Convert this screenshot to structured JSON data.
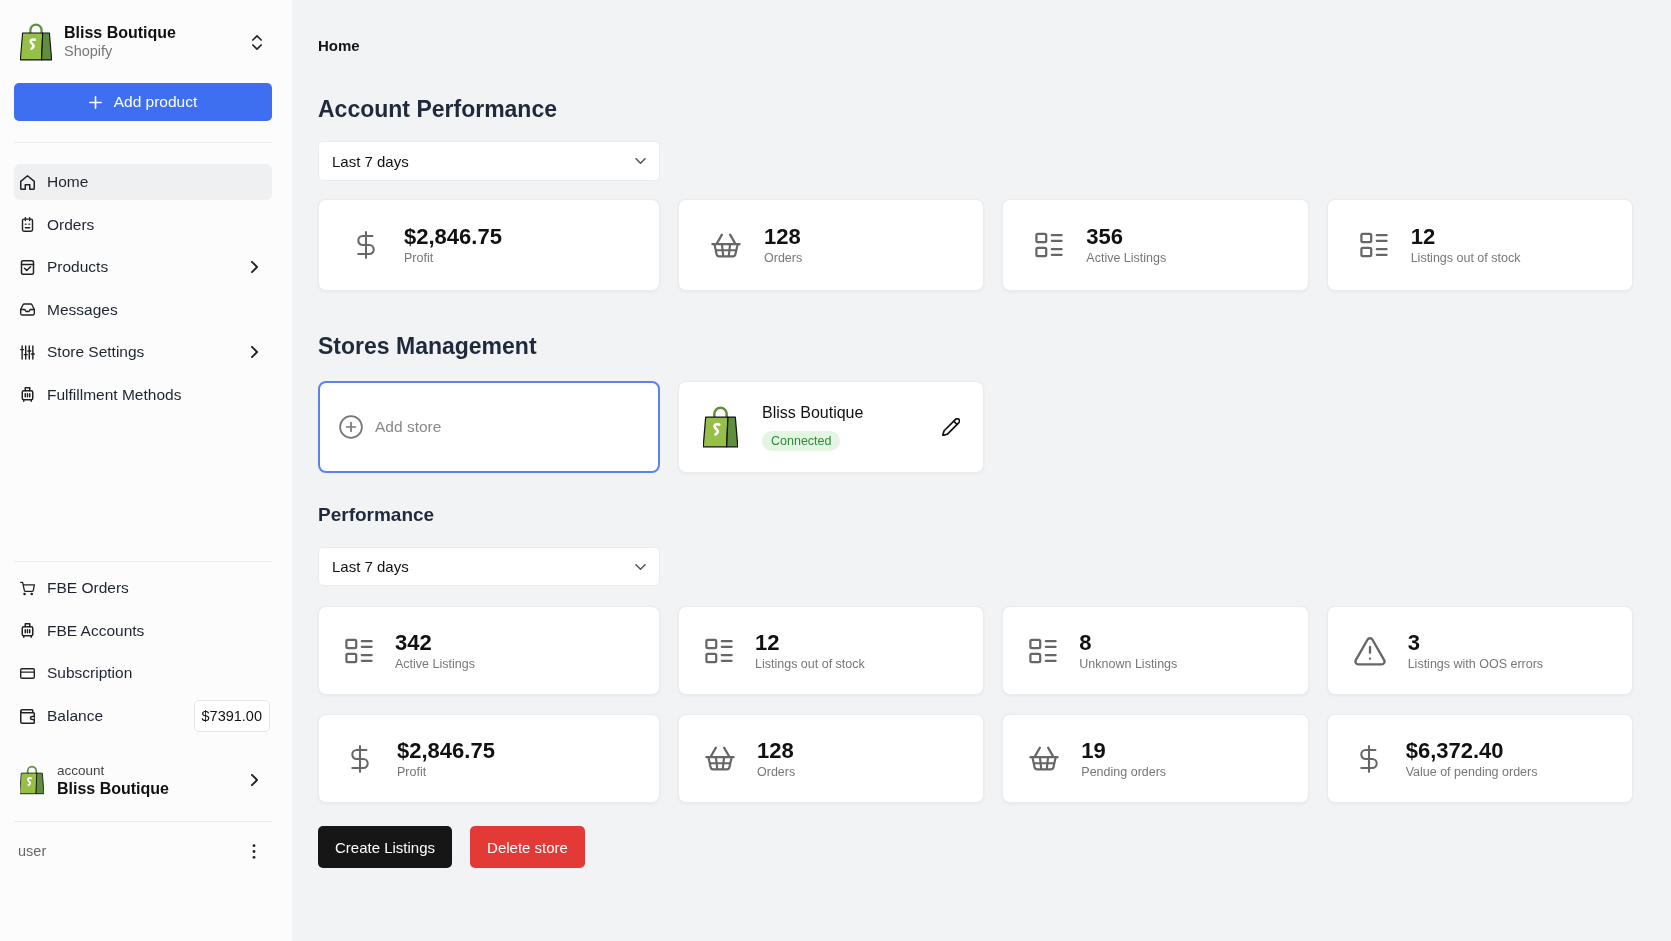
{
  "sidebar": {
    "store": {
      "name": "Bliss Boutique",
      "platform": "Shopify"
    },
    "add_button": {
      "label": "Add product"
    },
    "nav_items": [
      {
        "label": "Home",
        "selected": true,
        "expandable": false
      },
      {
        "label": "Orders",
        "selected": false,
        "expandable": false
      },
      {
        "label": "Products",
        "selected": false,
        "expandable": true
      },
      {
        "label": "Messages",
        "selected": false,
        "expandable": false
      },
      {
        "label": "Store Settings",
        "selected": false,
        "expandable": true
      },
      {
        "label": "Fulfillment Methods",
        "selected": false,
        "expandable": false
      }
    ],
    "secondary_items": [
      {
        "label": "FBE Orders",
        "selected": false
      },
      {
        "label": "FBE Accounts",
        "selected": false
      },
      {
        "label": "Subscription",
        "selected": false
      },
      {
        "label": "Balance",
        "selected": false,
        "badge": "$7391.00"
      }
    ],
    "account": {
      "caption": "account",
      "name": "Bliss Boutique"
    },
    "user": {
      "name": "user"
    }
  },
  "breadcrumb": "Home",
  "account_performance": {
    "title": "Account Performance",
    "period": {
      "value": "Last 7 days"
    },
    "stats": [
      {
        "kind": "money",
        "value": "$2,846.75",
        "label": "Profit"
      },
      {
        "kind": "orders",
        "value": "128",
        "label": "Orders"
      },
      {
        "kind": "listings",
        "value": "356",
        "label": "Active Listings"
      },
      {
        "kind": "listings",
        "value": "12",
        "label": "Listings out of stock"
      }
    ]
  },
  "stores_management": {
    "title": "Stores Management",
    "add_store": {
      "label": "Add store",
      "focused": true
    },
    "stores": [
      {
        "name": "Bliss Boutique",
        "status": "Connected"
      }
    ]
  },
  "performance": {
    "title": "Performance",
    "period": {
      "value": "Last 7 days"
    },
    "stats": [
      {
        "kind": "listings",
        "value": "342",
        "label": "Active Listings"
      },
      {
        "kind": "listings",
        "value": "12",
        "label": "Listings out of stock"
      },
      {
        "kind": "listings",
        "value": "8",
        "label": "Unknown Listings"
      },
      {
        "kind": "warning",
        "value": "3",
        "label": "Listings with OOS errors"
      },
      {
        "kind": "money",
        "value": "$2,846.75",
        "label": "Profit"
      },
      {
        "kind": "orders",
        "value": "128",
        "label": "Orders"
      },
      {
        "kind": "orders",
        "value": "19",
        "label": "Pending orders"
      },
      {
        "kind": "money",
        "value": "$6,372.40",
        "label": "Value of pending orders"
      }
    ]
  },
  "actions": [
    {
      "kind": "primary",
      "label": "Create Listings"
    },
    {
      "kind": "danger",
      "label": "Delete store"
    }
  ]
}
